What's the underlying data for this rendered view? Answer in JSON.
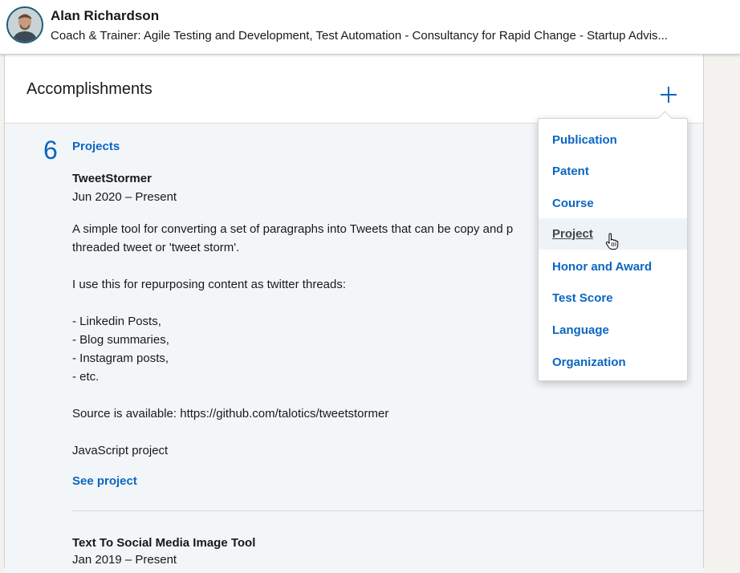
{
  "profile": {
    "name": "Alan Richardson",
    "headline": "Coach & Trainer: Agile Testing and Development, Test Automation - Consultancy for Rapid Change - Startup Advis..."
  },
  "card": {
    "title": "Accomplishments",
    "add_icon": "plus-icon"
  },
  "projects": {
    "count": "6",
    "label": "Projects",
    "items": [
      {
        "title": "TweetStormer",
        "date": "Jun 2020 – Present",
        "description": "A simple tool for converting a set of paragraphs into Tweets that can be copy and p\nthreaded tweet or 'tweet storm'.\n\nI use this for repurposing content as twitter threads:\n\n- Linkedin Posts,\n- Blog summaries,\n- Instagram posts,\n- etc.\n\nSource is available: https://github.com/talotics/tweetstormer\n\nJavaScript project",
        "link": "See project"
      },
      {
        "title": "Text To Social Media Image Tool",
        "date": "Jan 2019 – Present"
      }
    ]
  },
  "dropdown": {
    "items": [
      {
        "label": "Publication",
        "hovered": false
      },
      {
        "label": "Patent",
        "hovered": false
      },
      {
        "label": "Course",
        "hovered": false
      },
      {
        "label": "Project",
        "hovered": true
      },
      {
        "label": "Honor and Award",
        "hovered": false
      },
      {
        "label": "Test Score",
        "hovered": false
      },
      {
        "label": "Language",
        "hovered": false
      },
      {
        "label": "Organization",
        "hovered": false
      }
    ]
  },
  "colors": {
    "link": "#0a66c2",
    "body_bg": "#f3f6f8",
    "hover_bg": "#eef3f8"
  }
}
